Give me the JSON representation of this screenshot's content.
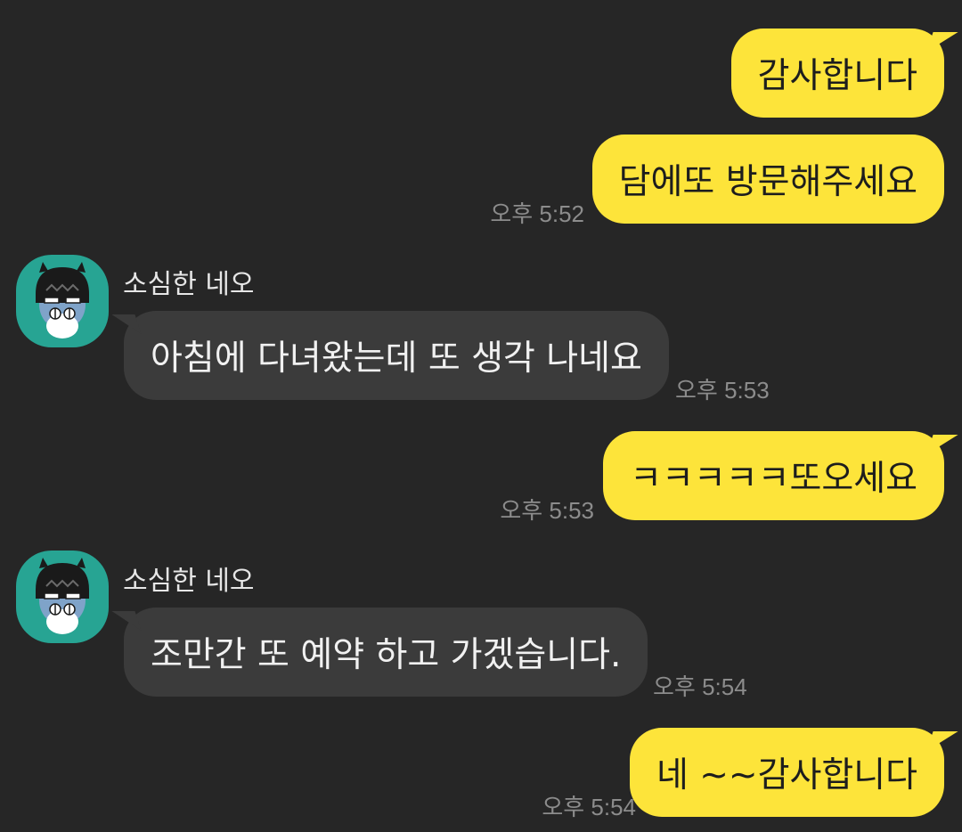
{
  "colors": {
    "background": "#262626",
    "my_bubble": "#fde43a",
    "their_bubble": "#3b3b3b",
    "avatar_bg": "#27a493",
    "timestamp": "#8c8c8c"
  },
  "messages": [
    {
      "from": "me",
      "text": "감사합니다"
    },
    {
      "from": "me",
      "text": "담에또 방문해주세요",
      "time": "오후 5:52"
    },
    {
      "from": "them",
      "sender": "소심한 네오",
      "avatar_icon": "neo-avatar-icon",
      "text": "아침에 다녀왔는데 또 생각 나네요",
      "time": "오후 5:53"
    },
    {
      "from": "me",
      "text": "ㅋㅋㅋㅋㅋ또오세요",
      "time": "오후 5:53"
    },
    {
      "from": "them",
      "sender": "소심한 네오",
      "avatar_icon": "neo-avatar-icon",
      "text": "조만간 또 예약 하고 가겠습니다.",
      "time": "오후 5:54"
    },
    {
      "from": "me",
      "text": "네 ~~감사합니다",
      "time": "오후 5:54"
    }
  ]
}
